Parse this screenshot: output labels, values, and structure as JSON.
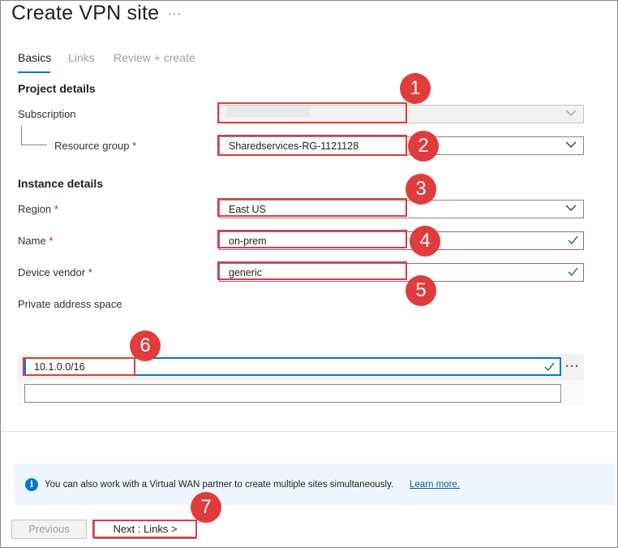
{
  "window": {
    "title": "Create VPN site",
    "more_label": "···"
  },
  "tabs": [
    {
      "label": "Basics"
    },
    {
      "label": "Links"
    },
    {
      "label": "Review + create"
    }
  ],
  "project": {
    "heading": "Project details",
    "subscription_label": "Subscription",
    "subscription_value": "",
    "resource_group_label": "Resource group",
    "resource_group_value": "Sharedservices-RG-1121128"
  },
  "instance": {
    "heading": "Instance details",
    "region_label": "Region",
    "region_value": "East US",
    "name_label": "Name",
    "name_value": "on-prem",
    "vendor_label": "Device vendor",
    "vendor_value": "generic",
    "address_label": "Private address space",
    "address_rows": [
      "10.1.0.0/16",
      ""
    ],
    "row_actions_label": "···"
  },
  "required_marker": "*",
  "info": {
    "text": "You can also work with a Virtual WAN partner to create multiple sites simultaneously.",
    "link": "Learn more.",
    "icon": "info-icon"
  },
  "footer": {
    "previous_label": "Previous",
    "next_label": "Next : Links >"
  },
  "callouts": [
    "1",
    "2",
    "3",
    "4",
    "5",
    "6",
    "7"
  ],
  "colors": {
    "accent": "#0078d4",
    "valid_border": "#8764b8",
    "valid_check": "#107c10",
    "annotation": "#e03c3c"
  }
}
